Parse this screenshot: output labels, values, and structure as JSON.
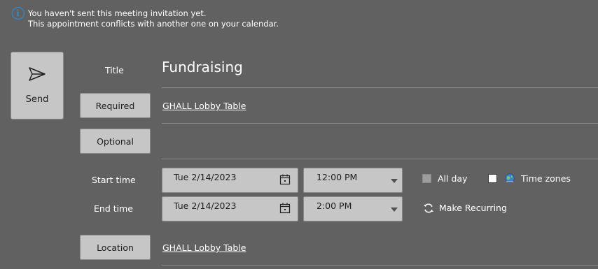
{
  "info_bar": {
    "line1": "You haven't sent this meeting invitation yet.",
    "line2": "This appointment conflicts with another one on your calendar.",
    "icon": "info-icon"
  },
  "send": {
    "label": "Send",
    "icon": "send-icon"
  },
  "title": {
    "label": "Title",
    "value": "Fundraising"
  },
  "required": {
    "button_label": "Required",
    "value": "GHALL Lobby Table"
  },
  "optional": {
    "button_label": "Optional",
    "value": ""
  },
  "start_time": {
    "label": "Start time",
    "date": "Tue 2/14/2023",
    "time": "12:00 PM"
  },
  "end_time": {
    "label": "End time",
    "date": "Tue 2/14/2023",
    "time": "2:00 PM"
  },
  "all_day": {
    "label": "All day",
    "checked": false,
    "enabled": false
  },
  "time_zones": {
    "label": "Time zones",
    "checked": false,
    "icon": "globe-icon"
  },
  "recurring": {
    "label": "Make Recurring",
    "icon": "recurring-icon"
  },
  "location": {
    "button_label": "Location",
    "value": "GHALL Lobby Table"
  },
  "colors": {
    "background": "#616161",
    "button": "#c6c6c6",
    "accent": "#2b8fd9"
  }
}
